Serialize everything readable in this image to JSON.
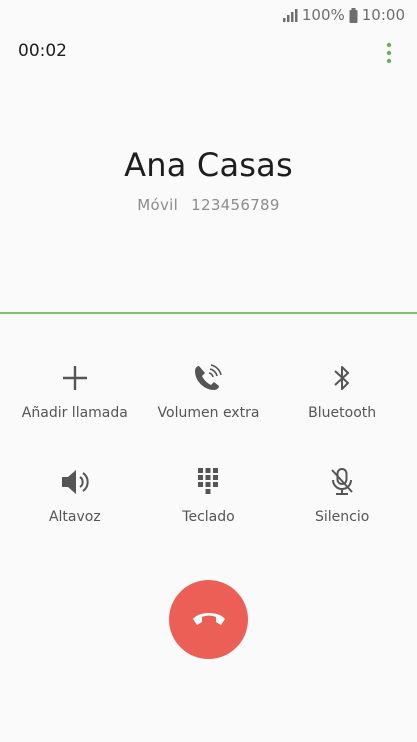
{
  "status_bar": {
    "battery_percent": "100%",
    "time": "10:00",
    "signal_icon": "signal-bars-icon",
    "battery_icon": "battery-icon"
  },
  "call": {
    "duration": "00:02",
    "contact_name": "Ana Casas",
    "number_type": "Móvil",
    "number": "123456789"
  },
  "controls": [
    {
      "label": "Añadir llamada",
      "icon": "add-call-icon"
    },
    {
      "label": "Volumen extra",
      "icon": "extra-volume-icon"
    },
    {
      "label": "Bluetooth",
      "icon": "bluetooth-icon"
    },
    {
      "label": "Altavoz",
      "icon": "speaker-icon"
    },
    {
      "label": "Teclado",
      "icon": "keypad-icon"
    },
    {
      "label": "Silencio",
      "icon": "mute-icon"
    }
  ],
  "colors": {
    "accent_green": "#7cc36b",
    "end_call_red": "#eb5f57"
  }
}
